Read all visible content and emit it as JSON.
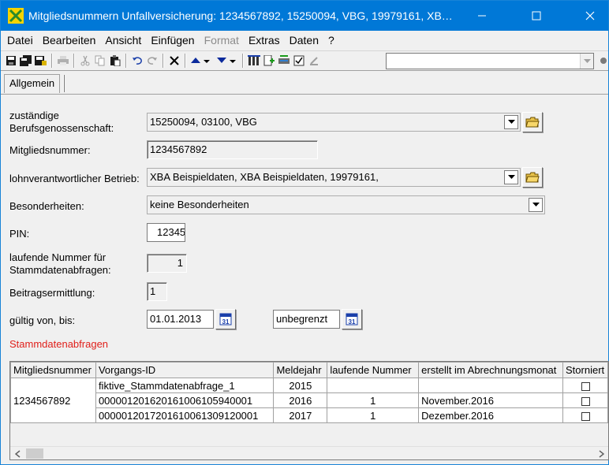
{
  "window": {
    "title": "Mitgliedsnummern Unfallversicherung: 1234567892, 15250094, VBG, 19979161, XB…"
  },
  "menu": [
    "Datei",
    "Bearbeiten",
    "Ansicht",
    "Einfügen",
    "Format",
    "Extras",
    "Daten",
    "?"
  ],
  "toolbar": {
    "search_value": ""
  },
  "tabs": [
    {
      "label": "Allgemein"
    }
  ],
  "form": {
    "berufsgenossenschaft": {
      "label_1": "zuständige",
      "label_2": "Berufsgenossenschaft:",
      "value": "15250094, 03100, VBG"
    },
    "mitgliedsnummer": {
      "label": "Mitgliedsnummer:",
      "value": "1234567892"
    },
    "betrieb": {
      "label": "lohnverantwortlicher Betrieb:",
      "value": "XBA Beispieldaten, XBA Beispieldaten, 19979161,"
    },
    "besonderheiten": {
      "label": "Besonderheiten:",
      "value": "keine Besonderheiten"
    },
    "pin": {
      "label": "PIN:",
      "value": "12345"
    },
    "laufende_nummer": {
      "label_1": "laufende Nummer für",
      "label_2": "Stammdatenabfragen:",
      "value": "1"
    },
    "beitragsermittlung": {
      "label": "Beitragsermittlung:",
      "value": "1"
    },
    "gueltig": {
      "label": "gültig von, bis:",
      "von": "01.01.2013",
      "bis": "unbegrenzt"
    }
  },
  "section_title": "Stammdatenabfragen",
  "grid": {
    "columns": [
      "Mitgliedsnummer",
      "Vorgangs-ID",
      "Meldejahr",
      "laufende Nummer",
      "erstellt im Abrechnungsmonat",
      "Storniert"
    ],
    "mitgliedsnummer": "1234567892",
    "rows": [
      {
        "vorgangs_id": "fiktive_Stammdatenabfrage_1",
        "meldejahr": "2015",
        "laufende_nummer": "",
        "monat": ""
      },
      {
        "vorgangs_id": "000001201620161006105940001",
        "meldejahr": "2016",
        "laufende_nummer": "1",
        "monat": "November.2016"
      },
      {
        "vorgangs_id": "000001201720161006130912000​1",
        "meldejahr": "2017",
        "laufende_nummer": "1",
        "monat": "Dezember.2016"
      }
    ]
  },
  "calendar_label": "31",
  "colors": {
    "titlebar": "#0078d7",
    "section_title": "#e0201b"
  }
}
